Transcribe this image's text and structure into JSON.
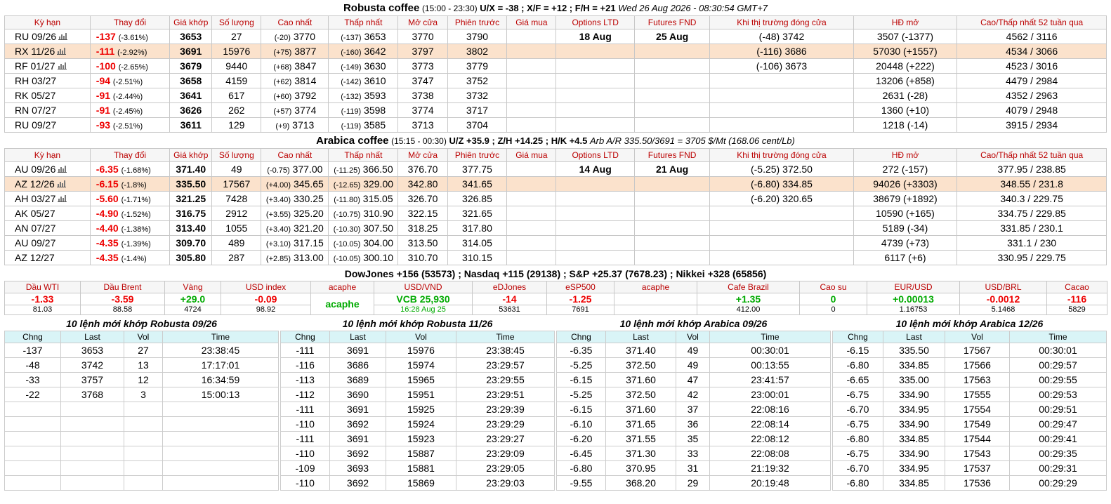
{
  "robusta": {
    "title_name": "Robusta coffee",
    "title_hours": "(15:00 - 23:30)",
    "title_spreads": "U/X = -38 ; X/F = +12 ; F/H = +21",
    "title_time": "Wed 26 Aug 2026 - 08:30:54 GMT+7",
    "headers": [
      "Kỳ hạn",
      "Thay đổi",
      "Giá khớp",
      "Số lượng",
      "Cao nhất",
      "Thấp nhất",
      "Mở cửa",
      "Phiên trước",
      "Giá mua",
      "Options LTD",
      "Futures FND",
      "Khi thị trường đóng cửa",
      "HĐ mở",
      "Cao/Thấp nhất 52 tuần qua"
    ],
    "options_ltd": "18 Aug",
    "futures_fnd": "25 Aug",
    "rows": [
      {
        "sym": "RU 09/26",
        "chg": "-137",
        "pct": "(-3.61%)",
        "last": "3653",
        "vol": "27",
        "hi_chg": "(-20)",
        "hi": "3770",
        "lo_chg": "(-137)",
        "lo": "3653",
        "open": "3770",
        "prev": "3790",
        "bid": "",
        "close_chg": "(-48)",
        "close": "3742",
        "oi": "3507 (-1377)",
        "w52": "4562 / 3116"
      },
      {
        "sym": "RX 11/26",
        "chg": "-111",
        "pct": "(-2.92%)",
        "last": "3691",
        "vol": "15976",
        "hi_chg": "(+75)",
        "hi": "3877",
        "lo_chg": "(-160)",
        "lo": "3642",
        "open": "3797",
        "prev": "3802",
        "bid": "",
        "close_chg": "(-116)",
        "close": "3686",
        "oi": "57030 (+1557)",
        "w52": "4534 / 3066"
      },
      {
        "sym": "RF 01/27",
        "chg": "-100",
        "pct": "(-2.65%)",
        "last": "3679",
        "vol": "9440",
        "hi_chg": "(+68)",
        "hi": "3847",
        "lo_chg": "(-149)",
        "lo": "3630",
        "open": "3773",
        "prev": "3779",
        "bid": "",
        "close_chg": "(-106)",
        "close": "3673",
        "oi": "20448 (+222)",
        "w52": "4523 / 3016"
      },
      {
        "sym": "RH 03/27",
        "chg": "-94",
        "pct": "(-2.51%)",
        "last": "3658",
        "vol": "4159",
        "hi_chg": "(+62)",
        "hi": "3814",
        "lo_chg": "(-142)",
        "lo": "3610",
        "open": "3747",
        "prev": "3752",
        "bid": "",
        "close_chg": "",
        "close": "",
        "oi": "13206 (+858)",
        "w52": "4479 / 2984"
      },
      {
        "sym": "RK 05/27",
        "chg": "-91",
        "pct": "(-2.44%)",
        "last": "3641",
        "vol": "617",
        "hi_chg": "(+60)",
        "hi": "3792",
        "lo_chg": "(-132)",
        "lo": "3593",
        "open": "3738",
        "prev": "3732",
        "bid": "",
        "close_chg": "",
        "close": "",
        "oi": "2631 (-28)",
        "w52": "4352 / 2963"
      },
      {
        "sym": "RN 07/27",
        "chg": "-91",
        "pct": "(-2.45%)",
        "last": "3626",
        "vol": "262",
        "hi_chg": "(+57)",
        "hi": "3774",
        "lo_chg": "(-119)",
        "lo": "3598",
        "open": "3774",
        "prev": "3717",
        "bid": "",
        "close_chg": "",
        "close": "",
        "oi": "1360 (+10)",
        "w52": "4079 / 2948"
      },
      {
        "sym": "RU 09/27",
        "chg": "-93",
        "pct": "(-2.51%)",
        "last": "3611",
        "vol": "129",
        "hi_chg": "(+9)",
        "hi": "3713",
        "lo_chg": "(-119)",
        "lo": "3585",
        "open": "3713",
        "prev": "3704",
        "bid": "",
        "close_chg": "",
        "close": "",
        "oi": "1218 (-14)",
        "w52": "3915 / 2934"
      }
    ]
  },
  "arabica": {
    "title_name": "Arabica coffee",
    "title_hours": "(15:15 - 00:30)",
    "title_spreads": "U/Z +35.9 ; Z/H +14.25 ; H/K +4.5",
    "title_arb": "Arb A/R 335.50/3691 = 3705 $/Mt (168.06 cent/Lb)",
    "headers": [
      "Kỳ hạn",
      "Thay đổi",
      "Giá khớp",
      "Số lượng",
      "Cao nhất",
      "Thấp nhất",
      "Mở cửa",
      "Phiên trước",
      "Giá mua",
      "Options LTD",
      "Futures FND",
      "Khi thị trường đóng cửa",
      "HĐ mở",
      "Cao/Thấp nhất 52 tuần qua"
    ],
    "options_ltd": "14 Aug",
    "futures_fnd": "21 Aug",
    "rows": [
      {
        "sym": "AU 09/26",
        "chg": "-6.35",
        "pct": "(-1.68%)",
        "last": "371.40",
        "vol": "49",
        "hi_chg": "(-0.75)",
        "hi": "377.00",
        "lo_chg": "(-11.25)",
        "lo": "366.50",
        "open": "376.70",
        "prev": "377.75",
        "bid": "",
        "close_chg": "(-5.25)",
        "close": "372.50",
        "oi": "272 (-157)",
        "w52": "377.95 / 238.85"
      },
      {
        "sym": "AZ 12/26",
        "chg": "-6.15",
        "pct": "(-1.8%)",
        "last": "335.50",
        "vol": "17567",
        "hi_chg": "(+4.00)",
        "hi": "345.65",
        "lo_chg": "(-12.65)",
        "lo": "329.00",
        "open": "342.80",
        "prev": "341.65",
        "bid": "",
        "close_chg": "(-6.80)",
        "close": "334.85",
        "oi": "94026 (+3303)",
        "w52": "348.55 / 231.8"
      },
      {
        "sym": "AH 03/27",
        "chg": "-5.60",
        "pct": "(-1.71%)",
        "last": "321.25",
        "vol": "7428",
        "hi_chg": "(+3.40)",
        "hi": "330.25",
        "lo_chg": "(-11.80)",
        "lo": "315.05",
        "open": "326.70",
        "prev": "326.85",
        "bid": "",
        "close_chg": "(-6.20)",
        "close": "320.65",
        "oi": "38679 (+1892)",
        "w52": "340.3 / 229.75"
      },
      {
        "sym": "AK 05/27",
        "chg": "-4.90",
        "pct": "(-1.52%)",
        "last": "316.75",
        "vol": "2912",
        "hi_chg": "(+3.55)",
        "hi": "325.20",
        "lo_chg": "(-10.75)",
        "lo": "310.90",
        "open": "322.15",
        "prev": "321.65",
        "bid": "",
        "close_chg": "",
        "close": "",
        "oi": "10590 (+165)",
        "w52": "334.75 / 229.85"
      },
      {
        "sym": "AN 07/27",
        "chg": "-4.40",
        "pct": "(-1.38%)",
        "last": "313.40",
        "vol": "1055",
        "hi_chg": "(+3.40)",
        "hi": "321.20",
        "lo_chg": "(-10.30)",
        "lo": "307.50",
        "open": "318.25",
        "prev": "317.80",
        "bid": "",
        "close_chg": "",
        "close": "",
        "oi": "5189 (-34)",
        "w52": "331.85 / 230.1"
      },
      {
        "sym": "AU 09/27",
        "chg": "-4.35",
        "pct": "(-1.39%)",
        "last": "309.70",
        "vol": "489",
        "hi_chg": "(+3.10)",
        "hi": "317.15",
        "lo_chg": "(-10.05)",
        "lo": "304.00",
        "open": "313.50",
        "prev": "314.05",
        "bid": "",
        "close_chg": "",
        "close": "",
        "oi": "4739 (+73)",
        "w52": "331.1 / 230"
      },
      {
        "sym": "AZ 12/27",
        "chg": "-4.35",
        "pct": "(-1.4%)",
        "last": "305.80",
        "vol": "287",
        "hi_chg": "(+2.85)",
        "hi": "313.00",
        "lo_chg": "(-10.05)",
        "lo": "300.10",
        "open": "310.70",
        "prev": "310.15",
        "bid": "",
        "close_chg": "",
        "close": "",
        "oi": "6117 (+6)",
        "w52": "330.95 / 229.75"
      }
    ]
  },
  "indices": {
    "title": "DowJones +156 (53573) ; Nasdaq +115 (29138) ; S&P +25.37 (7678.23) ; Nikkei +328 (65856)",
    "cells": [
      {
        "label": "Dầu WTI",
        "value": "-1.33",
        "sub": "81.03",
        "dir": "neg"
      },
      {
        "label": "Dầu Brent",
        "value": "-3.59",
        "sub": "88.58",
        "dir": "neg"
      },
      {
        "label": "Vàng",
        "value": "+29.0",
        "sub": "4724",
        "dir": "pos"
      },
      {
        "label": "USD index",
        "value": "-0.09",
        "sub": "98.92",
        "dir": "neg"
      },
      {
        "label": "acaphe",
        "value": "",
        "sub": "",
        "dir": "pos",
        "merged": "acaphe"
      },
      {
        "label": "USD/VND",
        "value": "VCB 25,930",
        "sub": "16:28 Aug 25",
        "dir": "pos"
      },
      {
        "label": "eDJones",
        "value": "-14",
        "sub": "53631",
        "dir": "neg"
      },
      {
        "label": "eSP500",
        "value": "-1.25",
        "sub": "7691",
        "dir": "neg"
      },
      {
        "label": "acaphe",
        "value": "",
        "sub": "",
        "dir": "pos"
      },
      {
        "label": "Cafe Brazil",
        "value": "+1.35",
        "sub": "412.00",
        "dir": "pos"
      },
      {
        "label": "Cao su",
        "value": "0",
        "sub": "0",
        "dir": "pos"
      },
      {
        "label": "EUR/USD",
        "value": "+0.00013",
        "sub": "1.16753",
        "dir": "pos"
      },
      {
        "label": "USD/BRL",
        "value": "-0.0012",
        "sub": "5.1468",
        "dir": "neg"
      },
      {
        "label": "Cacao",
        "value": "-116",
        "sub": "5829",
        "dir": "neg"
      }
    ]
  },
  "trades": [
    {
      "title": "10 lệnh mới khớp Robusta 09/26",
      "headers": [
        "Chng",
        "Last",
        "Vol",
        "Time"
      ],
      "rows": [
        [
          "-137",
          "3653",
          "27",
          "23:38:45"
        ],
        [
          "-48",
          "3742",
          "13",
          "17:17:01"
        ],
        [
          "-33",
          "3757",
          "12",
          "16:34:59"
        ],
        [
          "-22",
          "3768",
          "3",
          "15:00:13"
        ],
        [
          "",
          "",
          "",
          ""
        ],
        [
          "",
          "",
          "",
          ""
        ],
        [
          "",
          "",
          "",
          ""
        ],
        [
          "",
          "",
          "",
          ""
        ],
        [
          "",
          "",
          "",
          ""
        ],
        [
          "",
          "",
          "",
          ""
        ]
      ]
    },
    {
      "title": "10 lệnh mới khớp Robusta 11/26",
      "headers": [
        "Chng",
        "Last",
        "Vol",
        "Time"
      ],
      "rows": [
        [
          "-111",
          "3691",
          "15976",
          "23:38:45"
        ],
        [
          "-116",
          "3686",
          "15974",
          "23:29:57"
        ],
        [
          "-113",
          "3689",
          "15965",
          "23:29:55"
        ],
        [
          "-112",
          "3690",
          "15951",
          "23:29:51"
        ],
        [
          "-111",
          "3691",
          "15925",
          "23:29:39"
        ],
        [
          "-110",
          "3692",
          "15924",
          "23:29:29"
        ],
        [
          "-111",
          "3691",
          "15923",
          "23:29:27"
        ],
        [
          "-110",
          "3692",
          "15887",
          "23:29:09"
        ],
        [
          "-109",
          "3693",
          "15881",
          "23:29:05"
        ],
        [
          "-110",
          "3692",
          "15869",
          "23:29:03"
        ]
      ]
    },
    {
      "title": "10 lệnh mới khớp Arabica 09/26",
      "headers": [
        "Chng",
        "Last",
        "Vol",
        "Time"
      ],
      "rows": [
        [
          "-6.35",
          "371.40",
          "49",
          "00:30:01"
        ],
        [
          "-5.25",
          "372.50",
          "49",
          "00:13:55"
        ],
        [
          "-6.15",
          "371.60",
          "47",
          "23:41:57"
        ],
        [
          "-5.25",
          "372.50",
          "42",
          "23:00:01"
        ],
        [
          "-6.15",
          "371.60",
          "37",
          "22:08:16"
        ],
        [
          "-6.10",
          "371.65",
          "36",
          "22:08:14"
        ],
        [
          "-6.20",
          "371.55",
          "35",
          "22:08:12"
        ],
        [
          "-6.45",
          "371.30",
          "33",
          "22:08:08"
        ],
        [
          "-6.80",
          "370.95",
          "31",
          "21:19:32"
        ],
        [
          "-9.55",
          "368.20",
          "29",
          "20:19:48"
        ]
      ]
    },
    {
      "title": "10 lệnh mới khớp Arabica 12/26",
      "headers": [
        "Chng",
        "Last",
        "Vol",
        "Time"
      ],
      "rows": [
        [
          "-6.15",
          "335.50",
          "17567",
          "00:30:01"
        ],
        [
          "-6.80",
          "334.85",
          "17566",
          "00:29:57"
        ],
        [
          "-6.65",
          "335.00",
          "17563",
          "00:29:55"
        ],
        [
          "-6.75",
          "334.90",
          "17555",
          "00:29:53"
        ],
        [
          "-6.70",
          "334.95",
          "17554",
          "00:29:51"
        ],
        [
          "-6.75",
          "334.90",
          "17549",
          "00:29:47"
        ],
        [
          "-6.80",
          "334.85",
          "17544",
          "00:29:41"
        ],
        [
          "-6.75",
          "334.90",
          "17543",
          "00:29:35"
        ],
        [
          "-6.70",
          "334.95",
          "17537",
          "00:29:31"
        ],
        [
          "-6.80",
          "334.85",
          "17536",
          "00:29:29"
        ]
      ]
    }
  ],
  "colors": {
    "negative": "#e00000",
    "positive": "#00a000",
    "highlight_row": "#fbe2cc",
    "trade_header_bg": "#d9f4f7"
  },
  "icons": {
    "symbol_row_icon": "bar-chart-icon"
  }
}
